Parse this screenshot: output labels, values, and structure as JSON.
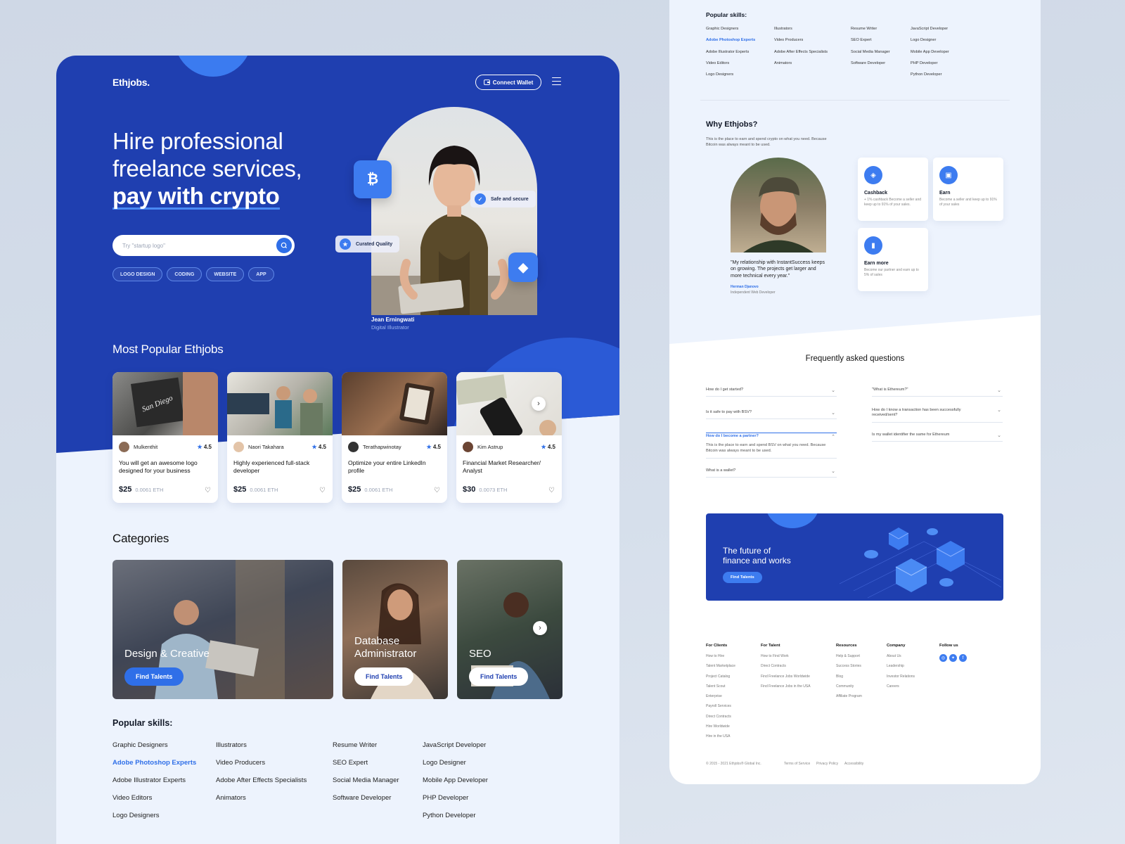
{
  "colors": {
    "brand_blue": "#1f3fb0",
    "accent": "#2f6fe8",
    "bg": "#cfd8e6",
    "light": "#edf3fd"
  },
  "header": {
    "logo": "Ethjobs.",
    "connect_wallet": "Connect Wallet",
    "menu_icon": "hamburger-icon"
  },
  "hero": {
    "title_line1": "Hire professional",
    "title_line2": "freelance services,",
    "title_highlight": "pay with crypto",
    "search_placeholder": "Try \"startup logo\"",
    "tags": [
      "LOGO DESIGN",
      "CODING",
      "WEBSITE",
      "APP"
    ],
    "badge_safe": "Safe and secure",
    "badge_quality": "Curated Quality",
    "person_name": "Jean Erningwati",
    "person_role": "Digital Illustrator"
  },
  "popular": {
    "title": "Most Popular Ethjobs",
    "cards": [
      {
        "seller": "Mulkenthit",
        "rating": "4.5",
        "desc": "You will get an awesome logo designed for your business",
        "price": "$25",
        "eth": "0.0061 ETH"
      },
      {
        "seller": "Naori Takahara",
        "rating": "4.5",
        "desc": "Highly experienced full-stack developer",
        "price": "$25",
        "eth": "0.0061 ETH"
      },
      {
        "seller": "Terathapwinotay",
        "rating": "4.5",
        "desc": "Optimize your entire LinkedIn profile",
        "price": "$25",
        "eth": "0.0061 ETH"
      },
      {
        "seller": "Kim Astrup",
        "rating": "4.5",
        "desc": "Financial Market Researcher/ Analyst",
        "price": "$30",
        "eth": "0.0073 ETH"
      }
    ]
  },
  "categories": {
    "title": "Categories",
    "items": [
      {
        "name": "Design & Creative",
        "cta": "Find Talents"
      },
      {
        "name": "Database Administrator",
        "cta": "Find Talents"
      },
      {
        "name": "SEO",
        "cta": "Find Talents"
      }
    ]
  },
  "skills": {
    "title": "Popular skills:",
    "col1": [
      "Graphic Designers",
      "Adobe Photoshop Experts",
      "Adobe Illustrator Experts",
      "Video Editors",
      "Logo Designers"
    ],
    "col2": [
      "Illustrators",
      "Video Producers",
      "Adobe After Effects Specialists",
      "Animators"
    ],
    "col3": [
      "Resume Writer",
      "SEO Expert",
      "Social Media Manager",
      "Software Developer"
    ],
    "col4": [
      "JavaScript Developer",
      "Logo Designer",
      "Mobile App Developer",
      "PHP Developer",
      "Python Developer"
    ]
  },
  "why": {
    "title": "Why Ethjobs?",
    "subtitle": "This is the place to earn and spend crypto on what you need. Because Bitcoin was always meant to be used.",
    "quote": "\"My relationship with InstantSuccess keeps on growing. The projects get larger and more technical every year.\"",
    "quote_name": "Herman Djanovo",
    "quote_role": "Independent Web Developer",
    "features": [
      {
        "title": "Cashback",
        "desc": "+ 1% cashback Become a seller and keep up to 91% of your sales."
      },
      {
        "title": "Earn",
        "desc": "Become a seller and keep up to 91% of your sales"
      },
      {
        "title": "Earn more",
        "desc": "Become our partner and earn up to 5% of sales"
      }
    ]
  },
  "faq": {
    "title": "Frequently asked questions",
    "left": [
      "How do I get started?",
      "Is it safe to pay with BSV?",
      "How do I become a partner?",
      "What is a wallet?"
    ],
    "open_answer": "This is the place to earn and spend BSV on what you need. Because Bitcoin was always meant to be used.",
    "right": [
      "\"What is Ethereum?\"",
      "How do I know a transaction has been successfully received/sent?",
      "Is my wallet identifier the same for Ethereum"
    ]
  },
  "banner": {
    "title": "The future of finance and works",
    "cta": "Find Talents"
  },
  "footer": {
    "clients": {
      "title": "For Clients",
      "links": [
        "How to Hire",
        "Talent Marketplace",
        "Project Catalog",
        "Talent Scout",
        "Enterprise",
        "Payroll Services",
        "Direct Contracts",
        "Hire Worldwide",
        "Hire in the USA"
      ]
    },
    "talent": {
      "title": "For Talent",
      "links": [
        "How to Find Work",
        "Direct Contracts",
        "Find Freelance Jobs Worldwide",
        "Find Freelance Jobs in the USA"
      ]
    },
    "resources": {
      "title": "Resources",
      "links": [
        "Help & Support",
        "Success Stories",
        "Blog",
        "Community",
        "Affiliate Program"
      ]
    },
    "company": {
      "title": "Company",
      "links": [
        "About Us",
        "Leadership",
        "Investor Relations",
        "Careers"
      ]
    },
    "follow": {
      "title": "Follow us"
    },
    "copyright": "© 2015 - 2021 Ethjobs® Global Inc.",
    "legal": [
      "Terms of Service",
      "Privacy Policy",
      "Accessibility"
    ]
  }
}
